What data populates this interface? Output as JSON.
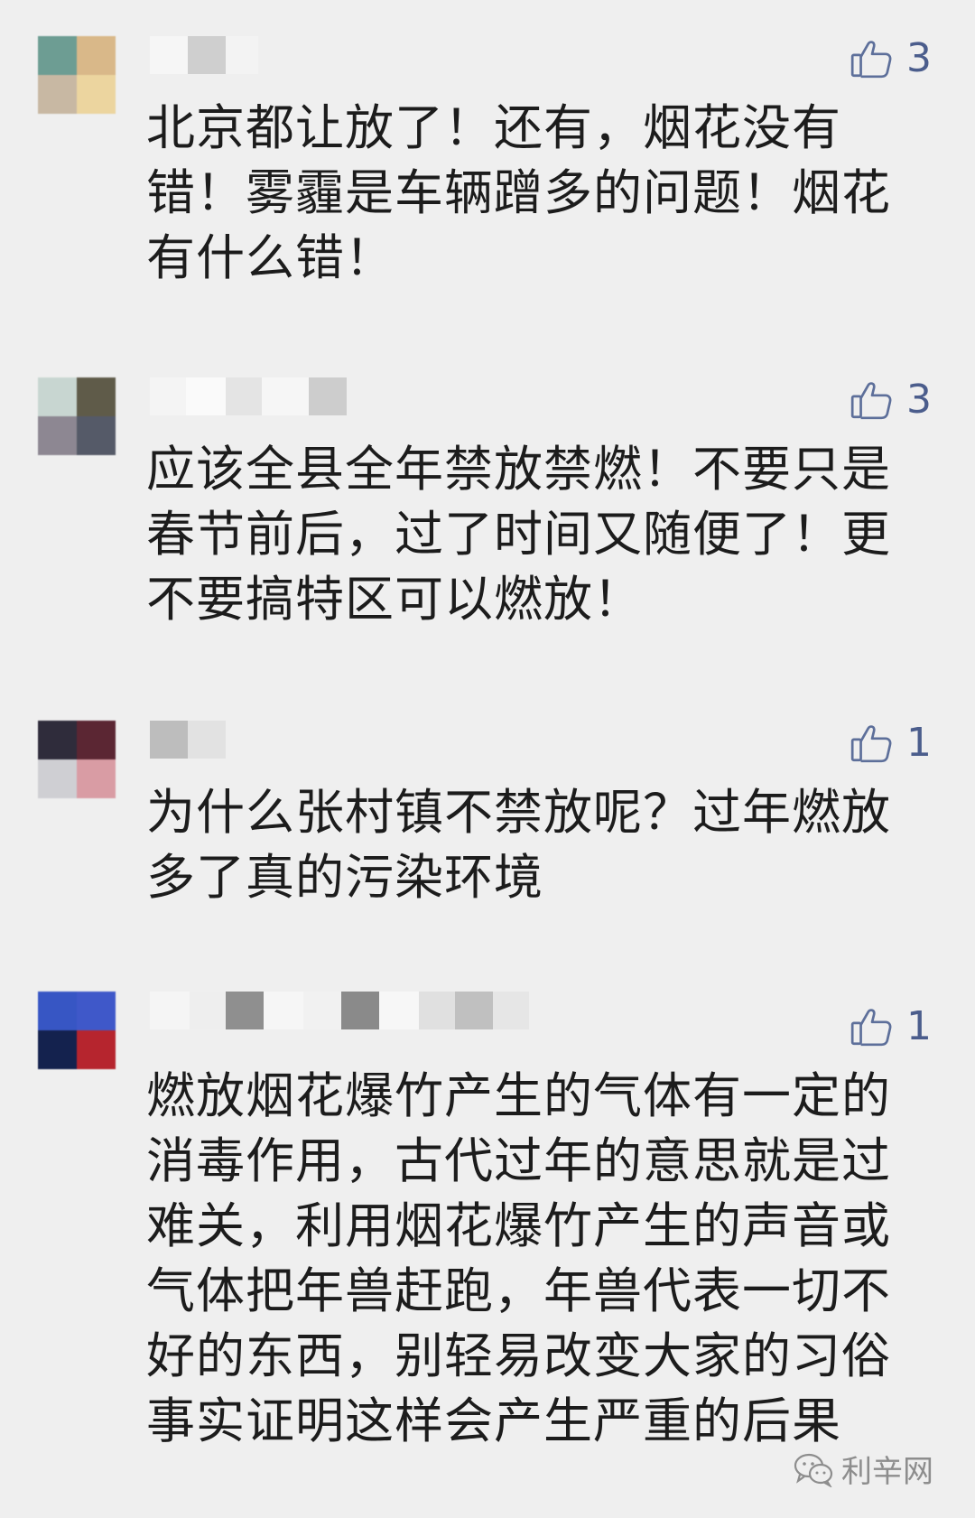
{
  "comments": [
    {
      "likes": "3",
      "text": "北京都让放了！还有，烟花没有错！雾霾是车辆蹭多的问题！烟花有什么错！",
      "avatar_colors": [
        "#6d9d93",
        "#d9b889",
        "#c8b8a3",
        "#ecd59f"
      ]
    },
    {
      "likes": "3",
      "text": "应该全县全年禁放禁燃！不要只是春节前后，过了时间又随便了！更不要搞特区可以燃放！",
      "avatar_colors": [
        "#c8d6d1",
        "#5f5b49",
        "#8d8792",
        "#555a68"
      ]
    },
    {
      "likes": "1",
      "text": "为什么张村镇不禁放呢？过年燃放多了真的污染环境",
      "avatar_colors": [
        "#2f2c3b",
        "#5b2633",
        "#cfcfd3",
        "#d99ca4"
      ]
    },
    {
      "likes": "1",
      "text": "燃放烟花爆竹产生的气体有一定的消毒作用，古代过年的意思就是过难关，利用烟花爆竹产生的声音或气体把年兽赶跑，年兽代表一切不好的东西，别轻易改变大家的习俗事实证明这样会产生严重的后果",
      "avatar_colors": [
        "#3756c4",
        "#3f58c9",
        "#14224e",
        "#b6252e"
      ]
    }
  ],
  "watermark": "利辛网",
  "icons": {
    "like": "thumbs-up-icon",
    "watermark": "wechat-icon"
  }
}
